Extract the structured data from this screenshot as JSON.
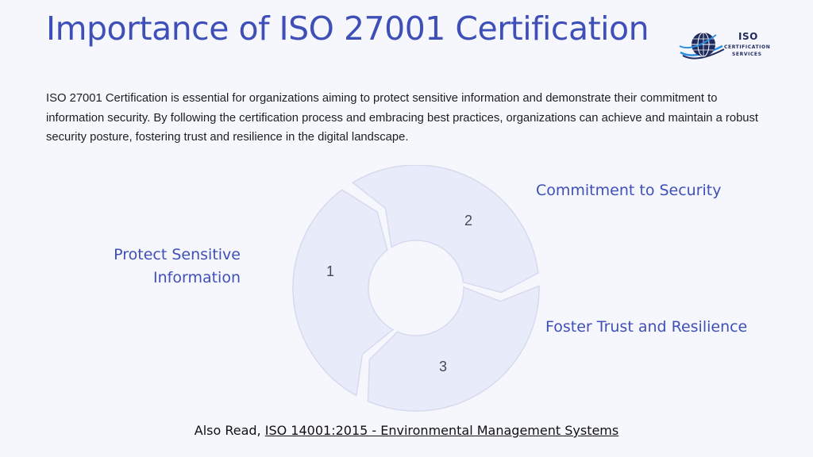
{
  "title": "Importance of ISO 27001 Certification",
  "logo": {
    "line1": "ISO",
    "line2": "CERTIFICATION",
    "line3": "SERVICES",
    "icon": "globe-icon"
  },
  "intro": "ISO 27001 Certification is essential for organizations aiming to protect sensitive information and demonstrate their commitment to information security. By following the certification process and embracing best practices, organizations can achieve and maintain a robust security posture, fostering trust and resilience in the digital landscape.",
  "diagram": {
    "type": "cycle",
    "segments": [
      {
        "number": "1",
        "label": "Protect Sensitive Information"
      },
      {
        "number": "2",
        "label": "Commitment to Security"
      },
      {
        "number": "3",
        "label": "Foster Trust and Resilience"
      }
    ],
    "colors": {
      "segment_fill": "#e8ebf9",
      "segment_stroke": "#d6daee",
      "label_color": "#3f4fb8"
    }
  },
  "footer": {
    "prefix": "Also Read, ",
    "link_text": "ISO 14001:2015 - Environmental Management Systems"
  }
}
